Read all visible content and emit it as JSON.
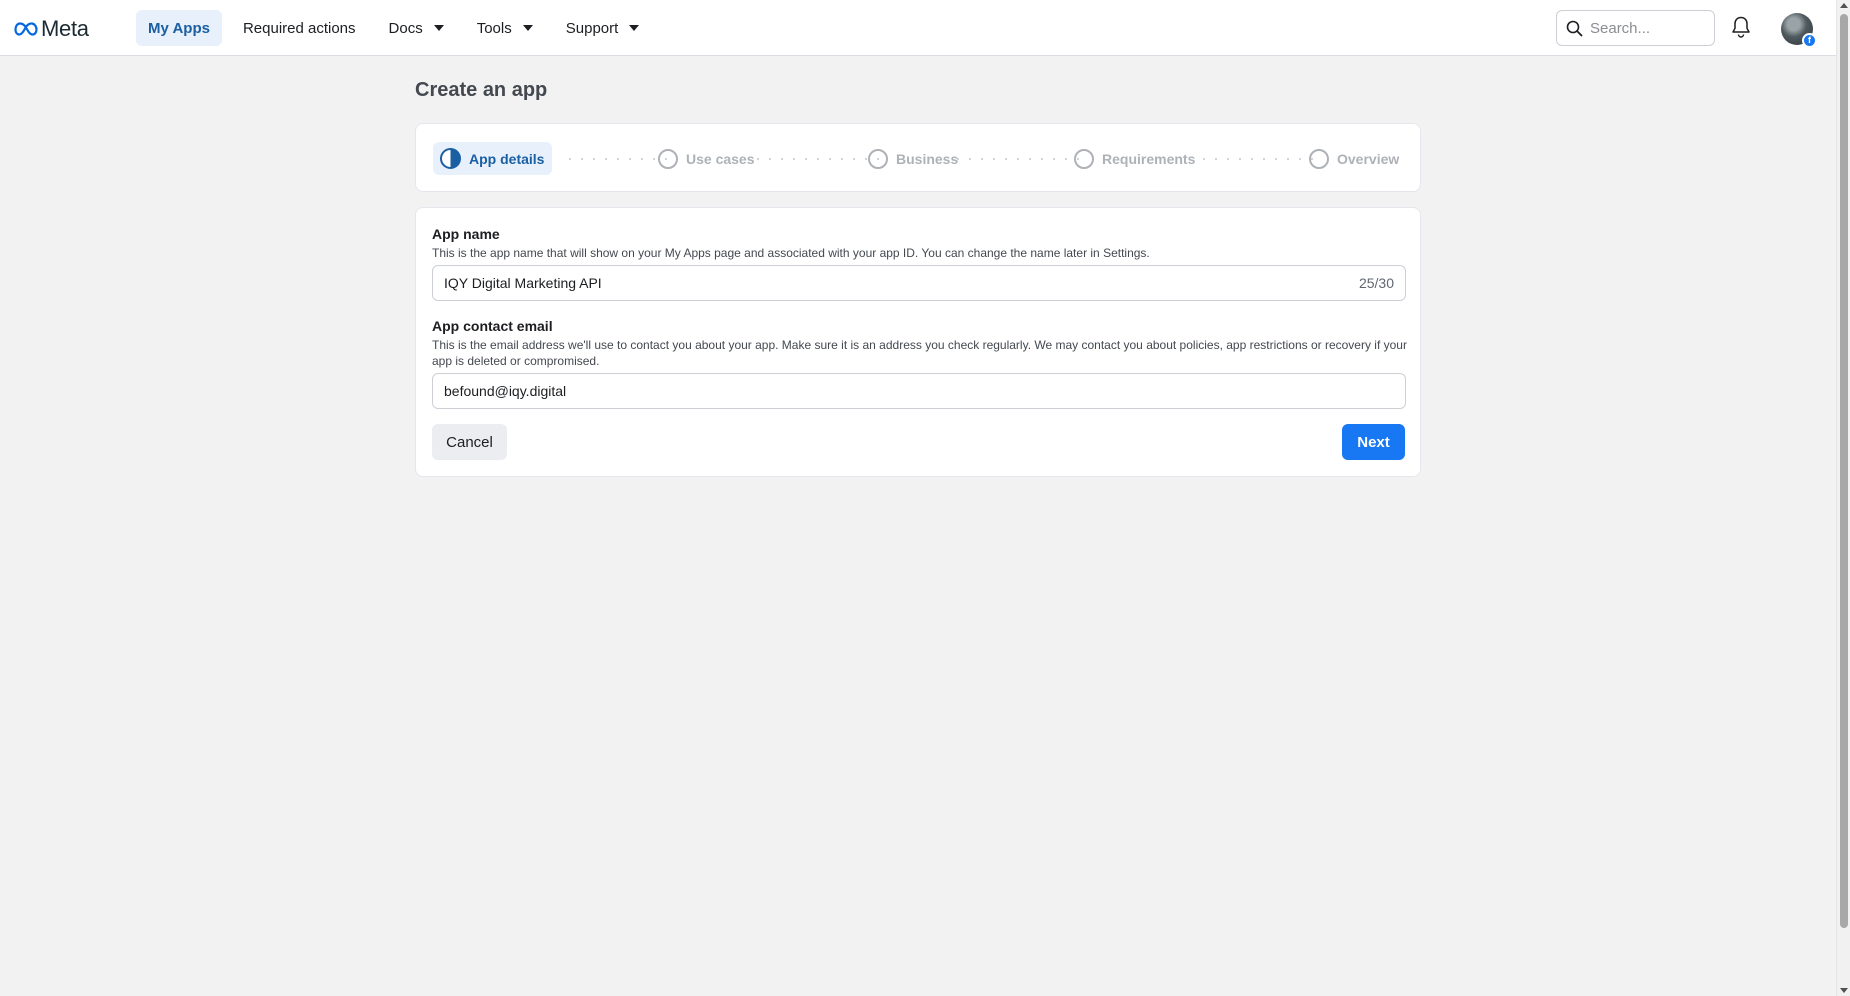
{
  "topbar": {
    "logo_text": "Meta",
    "nav": [
      {
        "label": "My Apps",
        "active": true,
        "dropdown": false
      },
      {
        "label": "Required actions",
        "active": false,
        "dropdown": false
      },
      {
        "label": "Docs",
        "active": false,
        "dropdown": true
      },
      {
        "label": "Tools",
        "active": false,
        "dropdown": true
      },
      {
        "label": "Support",
        "active": false,
        "dropdown": true
      }
    ],
    "search_placeholder": "Search..."
  },
  "page": {
    "title": "Create an app"
  },
  "stepper": {
    "steps": [
      {
        "label": "App details",
        "state": "in-progress"
      },
      {
        "label": "Use cases",
        "state": "pending"
      },
      {
        "label": "Business",
        "state": "pending"
      },
      {
        "label": "Requirements",
        "state": "pending"
      },
      {
        "label": "Overview",
        "state": "pending"
      }
    ]
  },
  "form": {
    "app_name": {
      "label": "App name",
      "help": "This is the app name that will show on your My Apps page and associated with your app ID. You can change the name later in Settings.",
      "value": "IQY Digital Marketing API",
      "counter": "25/30"
    },
    "contact_email": {
      "label": "App contact email",
      "help": "This is the email address we'll use to contact you about your app. Make sure it is an address you check regularly. We may contact you about policies, app restrictions or recovery if your app is deleted or compromised.",
      "value": "befound@iqy.digital"
    },
    "cancel_label": "Cancel",
    "next_label": "Next"
  },
  "colors": {
    "accent": "#1877f2",
    "active_nav_bg": "#e7f0fb",
    "active_nav_text": "#1b5fa3",
    "page_bg": "#f2f2f2"
  }
}
